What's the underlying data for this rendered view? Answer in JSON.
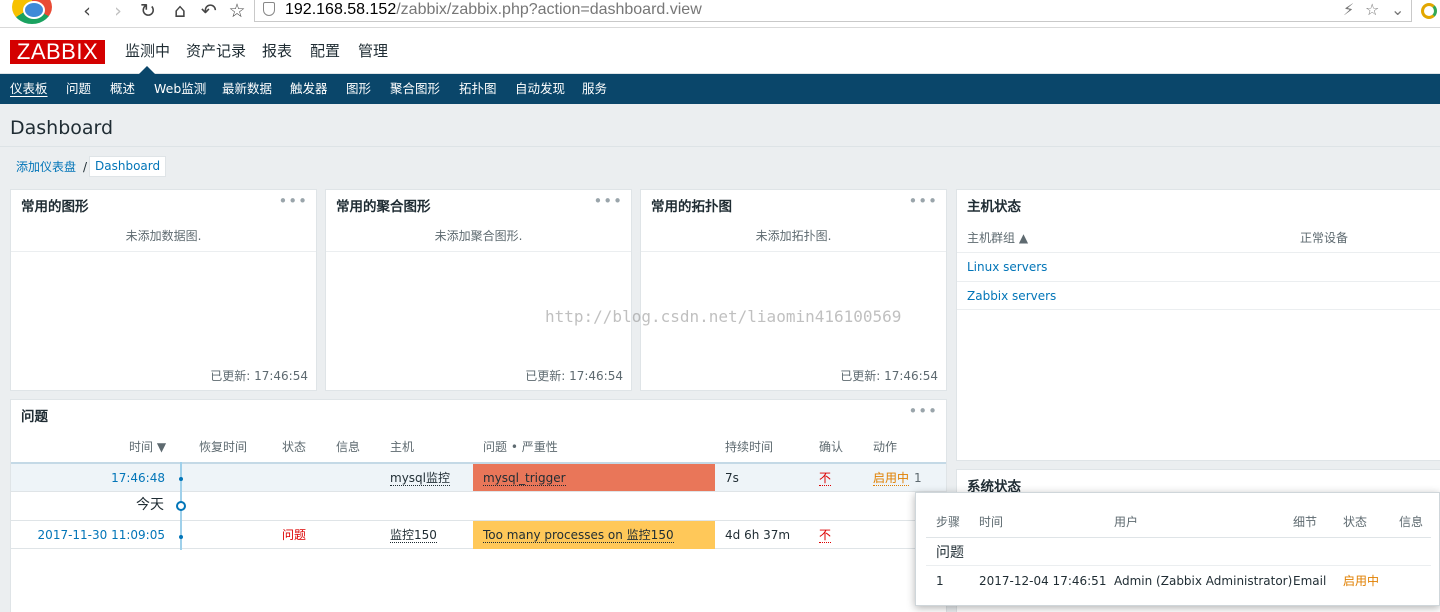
{
  "browser": {
    "url_host": "192.168.58.152",
    "url_path": "/zabbix/zabbix.php?action=dashboard.view"
  },
  "logo": "ZABBIX",
  "main_menu": [
    "监测中",
    "资产记录",
    "报表",
    "配置",
    "管理"
  ],
  "sub_nav": [
    "仪表板",
    "问题",
    "概述",
    "Web监测",
    "最新数据",
    "触发器",
    "图形",
    "聚合图形",
    "拓扑图",
    "自动发现",
    "服务"
  ],
  "page": {
    "title": "Dashboard",
    "breadcrumb_add": "添加仪表盘",
    "breadcrumb_sep": "/",
    "breadcrumb_current": "Dashboard"
  },
  "widgets": {
    "graphs": {
      "title": "常用的图形",
      "empty": "未添加数据图.",
      "updated": "已更新: 17:46:54"
    },
    "screens": {
      "title": "常用的聚合图形",
      "empty": "未添加聚合图形.",
      "updated": "已更新: 17:46:54"
    },
    "maps": {
      "title": "常用的拓扑图",
      "empty": "未添加拓扑图.",
      "updated": "已更新: 17:46:54"
    },
    "host_status": {
      "title": "主机状态",
      "col_group": "主机群组 ▲",
      "col_ok": "正常设备",
      "rows": [
        "Linux servers",
        "Zabbix servers"
      ]
    },
    "system_status": {
      "title": "系统状态"
    },
    "problems": {
      "title": "问题",
      "columns": [
        "时间 ▼",
        "恢复时间",
        "状态",
        "信息",
        "主机",
        "问题 • 严重性",
        "持续时间",
        "确认",
        "动作"
      ],
      "rows": [
        {
          "time": "17:46:48",
          "recovery": "",
          "status": "",
          "info": "",
          "host": "mysql监控",
          "problem": "mysql_trigger",
          "duration": "7s",
          "ack": "不",
          "action": "启用中",
          "action_count": "1"
        },
        {
          "time": "2017-11-30 11:09:05",
          "recovery": "",
          "status": "问题",
          "info": "",
          "host": "监控150",
          "problem": "Too many processes on 监控150",
          "duration": "4d 6h 37m",
          "ack": "不",
          "action": "",
          "action_count": ""
        }
      ],
      "today_label": "今天"
    }
  },
  "hint": {
    "columns": [
      "步骤",
      "时间",
      "用户",
      "细节",
      "状态",
      "信息"
    ],
    "group": "问题",
    "row": {
      "step": "1",
      "time": "2017-12-04 17:46:51",
      "user": "Admin (Zabbix Administrator)",
      "details": "Email",
      "status": "启用中",
      "info": ""
    }
  },
  "watermark": "http://blog.csdn.net/liaomin416100569",
  "colors": {
    "header_bg": "#0a466a",
    "logo_red": "#d40000",
    "link": "#0275b8",
    "sev_high": "#e97659",
    "sev_average": "#ffc859",
    "problem_red": "#dc0000",
    "action_orange": "#e07f00"
  }
}
